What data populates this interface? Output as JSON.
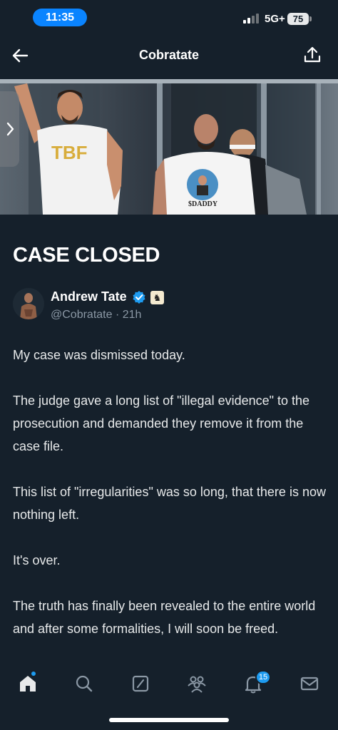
{
  "status_bar": {
    "time": "11:35",
    "network": "5G+",
    "battery": "75"
  },
  "nav": {
    "title": "Cobratate",
    "back_icon": "arrow-left-icon",
    "share_icon": "share-icon"
  },
  "hero": {
    "shirt_text_left": "TBF",
    "shirt_text_right": "$DADDY"
  },
  "article": {
    "title": "CASE CLOSED",
    "author": {
      "name": "Andrew Tate",
      "handle": "@Cobratate",
      "time": "21h",
      "verified_color": "#1d9bf0"
    },
    "paragraphs": [
      "My case was dismissed today.",
      "The judge gave a long list of \"illegal evidence\" to the prosecution and demanded they remove it from the case file.",
      "This list of \"irregularities\" was so long, that there is now nothing left.",
      "It's over.",
      "The truth has finally been revealed to the entire world and after some formalities, I will soon be freed."
    ]
  },
  "tab_bar": {
    "tabs": [
      "home-icon",
      "search-icon",
      "grok-icon",
      "communities-icon",
      "notifications-icon",
      "messages-icon"
    ],
    "notification_count": "15"
  },
  "colors": {
    "background": "#15202b",
    "accent": "#1d9bf0",
    "time_pill": "#0a84ff"
  }
}
